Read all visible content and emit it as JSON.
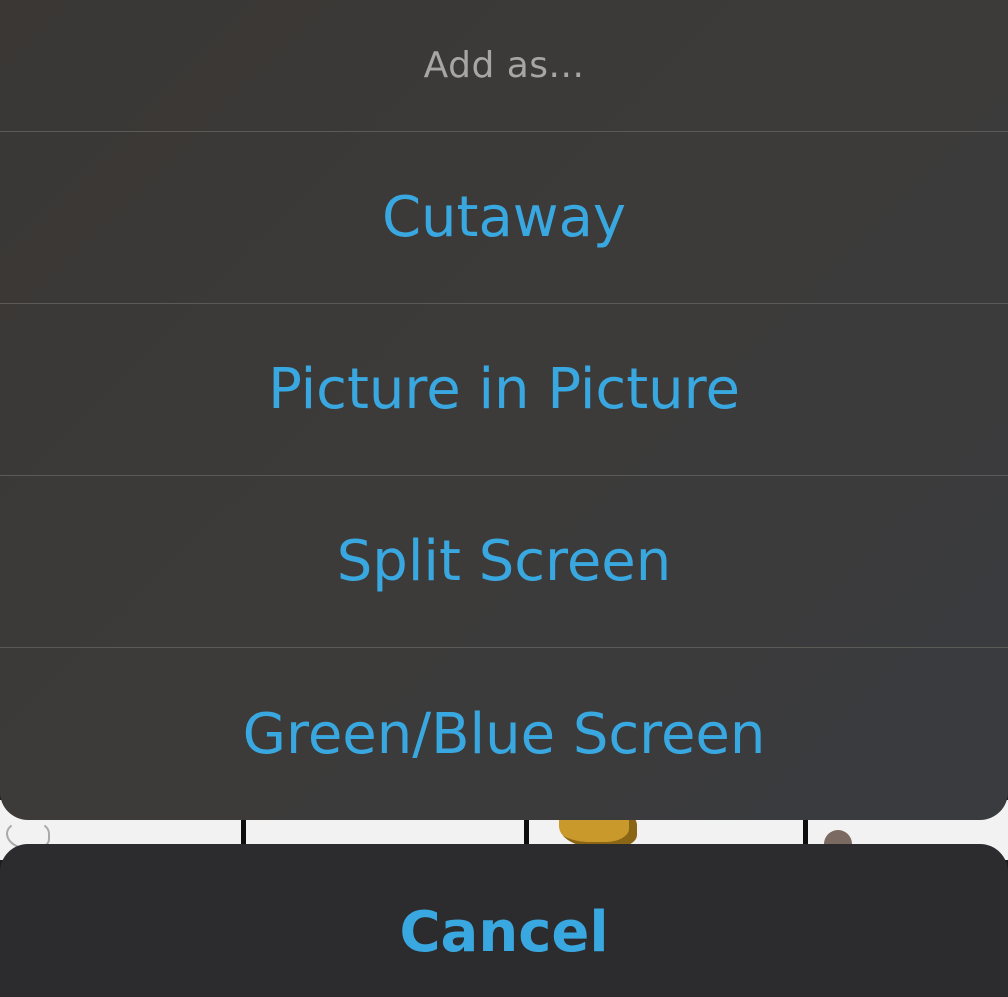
{
  "sheet": {
    "title": "Add as...",
    "actions": [
      {
        "label": "Cutaway"
      },
      {
        "label": "Picture in Picture"
      },
      {
        "label": "Split Screen"
      },
      {
        "label": "Green/Blue Screen"
      }
    ]
  },
  "cancel": {
    "label": "Cancel"
  },
  "colors": {
    "action_text": "#3aa8e0",
    "title_text": "#a6a6a6",
    "sheet_bg": "#3b3a39",
    "cancel_bg": "#2c2c2e"
  },
  "icons": {
    "thumbnails": [
      "scribble-thumbnail",
      "blank-thumbnail",
      "sprite-thumbnail",
      "avatar-thumbnail"
    ]
  }
}
